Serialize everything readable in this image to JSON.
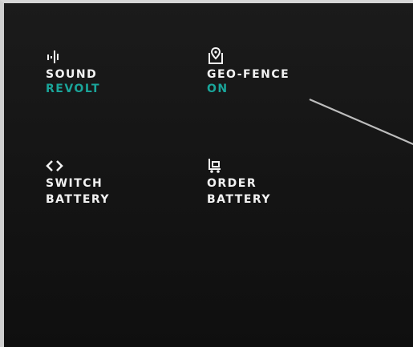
{
  "tiles": {
    "sound": {
      "label": "SOUND",
      "status": "REVOLT",
      "icon": "sound-waves-icon"
    },
    "geofence": {
      "label": "GEO-FENCE",
      "status": "ON",
      "icon": "geo-fence-pin-icon"
    },
    "switch_battery": {
      "label_line1": "SWITCH",
      "label_line2": "BATTERY",
      "icon": "switch-arrows-icon"
    },
    "order_battery": {
      "label_line1": "ORDER",
      "label_line2": "BATTERY",
      "icon": "battery-cart-icon"
    }
  },
  "colors": {
    "background": "#151515",
    "text": "#f2f2f2",
    "accent": "#1aa59a",
    "callout_line": "#bdbdbd"
  }
}
